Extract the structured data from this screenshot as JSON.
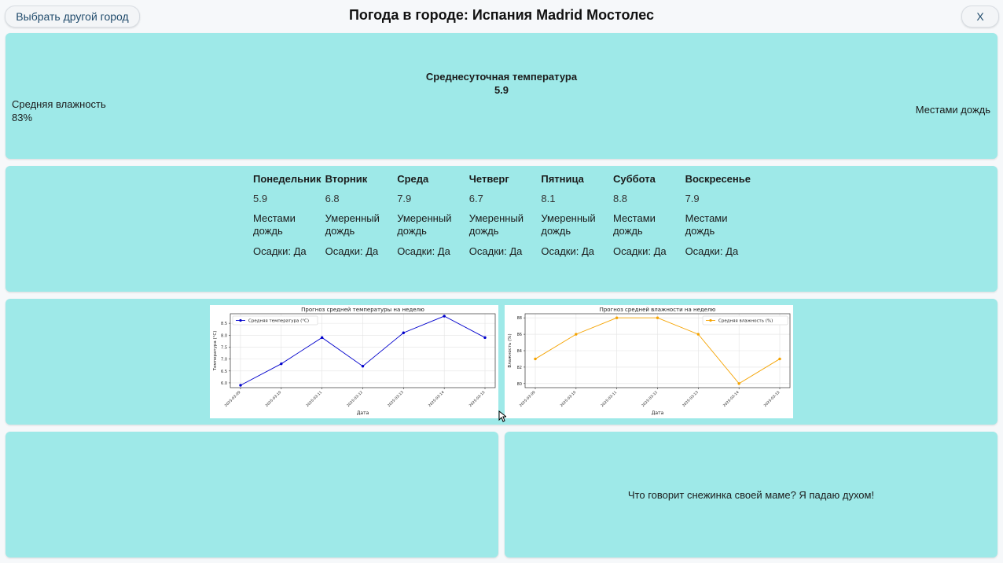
{
  "header": {
    "choose_city_label": "Выбрать другой город",
    "title": "Погода в городе: Испания Madrid Мостолес",
    "close_label": "X"
  },
  "current": {
    "avg_temp_label": "Среднесуточная температура",
    "avg_temp_value": "5.9",
    "humidity_label": "Средняя влажность",
    "humidity_value": "83%",
    "condition": "Местами дождь"
  },
  "week": [
    {
      "day": "Понедельник",
      "temp": "5.9",
      "condition": "Местами дождь",
      "precip": "Осадки: Да"
    },
    {
      "day": "Вторник",
      "temp": "6.8",
      "condition": "Умеренный дождь",
      "precip": "Осадки: Да"
    },
    {
      "day": "Среда",
      "temp": "7.9",
      "condition": "Умеренный дождь",
      "precip": "Осадки: Да"
    },
    {
      "day": "Четверг",
      "temp": "6.7",
      "condition": "Умеренный дождь",
      "precip": "Осадки: Да"
    },
    {
      "day": "Пятница",
      "temp": "8.1",
      "condition": "Умеренный дождь",
      "precip": "Осадки: Да"
    },
    {
      "day": "Суббота",
      "temp": "8.8",
      "condition": "Местами дождь",
      "precip": "Осадки: Да"
    },
    {
      "day": "Воскресенье",
      "temp": "7.9",
      "condition": "Местами дождь",
      "precip": "Осадки: Да"
    }
  ],
  "chart_data": [
    {
      "type": "line",
      "title": "Прогноз средней температуры на неделю",
      "xlabel": "Дата",
      "ylabel": "Температура (°C)",
      "x": [
        "2025-03-09",
        "2025-03-10",
        "2025-03-11",
        "2025-03-12",
        "2025-03-13",
        "2025-03-14",
        "2025-03-15"
      ],
      "series": [
        {
          "name": "Средняя температура (°C)",
          "values": [
            5.9,
            6.8,
            7.9,
            6.7,
            8.1,
            8.8,
            7.9
          ],
          "color": "#0000cc"
        }
      ],
      "ylim": [
        5.8,
        8.9
      ],
      "yticks": [
        6.0,
        6.5,
        7.0,
        7.5,
        8.0,
        8.5
      ],
      "ytick_labels": [
        "6.0",
        "6.5",
        "7.0",
        "7.5",
        "8.0",
        "8.5"
      ],
      "grid": true,
      "legend": "top-left"
    },
    {
      "type": "line",
      "title": "Прогноз средней влажности на неделю",
      "xlabel": "Дата",
      "ylabel": "Влажность (%)",
      "x": [
        "2025-03-09",
        "2025-03-10",
        "2025-03-11",
        "2025-03-12",
        "2025-03-13",
        "2025-03-14",
        "2025-03-15"
      ],
      "series": [
        {
          "name": "Средняя влажность (%)",
          "values": [
            83,
            86,
            88,
            88,
            86,
            80,
            83
          ],
          "color": "#f5a300"
        }
      ],
      "ylim": [
        79.5,
        88.5
      ],
      "yticks": [
        80,
        82,
        84,
        86,
        88
      ],
      "ytick_labels": [
        "80",
        "82",
        "84",
        "86",
        "88"
      ],
      "grid": true,
      "legend": "top-right"
    }
  ],
  "joke": "Что говорит снежинка своей маме? Я падаю духом!"
}
